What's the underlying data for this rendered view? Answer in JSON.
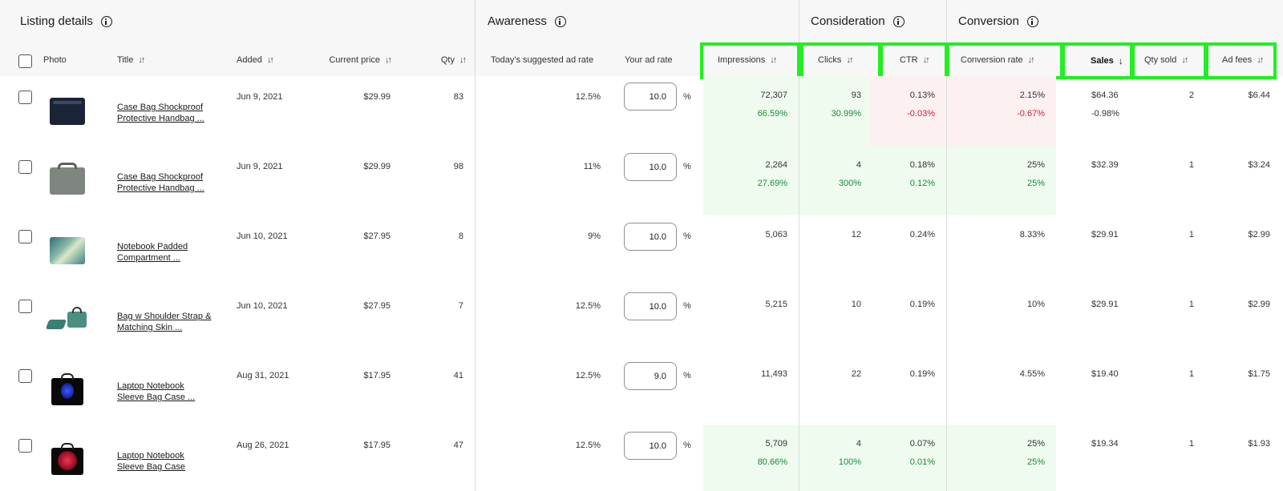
{
  "groups": {
    "listing_details": "Listing details",
    "awareness": "Awareness",
    "consideration": "Consideration",
    "conversion": "Conversion"
  },
  "columns": {
    "photo": "Photo",
    "title": "Title",
    "added": "Added",
    "current_price": "Current price",
    "qty": "Qty",
    "suggested_rate": "Today's suggested ad rate",
    "your_rate": "Your ad rate",
    "impressions": "Impressions",
    "clicks": "Clicks",
    "ctr": "CTR",
    "conversion_rate": "Conversion rate",
    "sales": "Sales",
    "qty_sold": "Qty sold",
    "ad_fees": "Ad fees"
  },
  "colors": {
    "highlight": "#22ee22",
    "positive": "#1a8a3a",
    "negative": "#d11d3c",
    "green_cell": "#eefbee",
    "red_cell": "#fdf0f0"
  },
  "rows": [
    {
      "title": "Case Bag Shockproof Protective Handbag ...",
      "added": "Jun 9, 2021",
      "price": "$29.99",
      "qty": "83",
      "suggested_rate": "12.5%",
      "ad_rate": "10.0",
      "impressions": "72,307",
      "impressions_delta": "66.59%",
      "clicks": "93",
      "clicks_delta": "30.99%",
      "ctr": "0.13%",
      "ctr_delta": "-0.03%",
      "conversion_rate": "2.15%",
      "conversion_rate_delta": "-0.67%",
      "sales": "$64.36",
      "sales_delta": "-0.98%",
      "qty_sold": "2",
      "ad_fees": "$6.44"
    },
    {
      "title": "Case Bag Shockproof Protective Handbag ...",
      "added": "Jun 9, 2021",
      "price": "$29.99",
      "qty": "98",
      "suggested_rate": "11%",
      "ad_rate": "10.0",
      "impressions": "2,264",
      "impressions_delta": "27.69%",
      "clicks": "4",
      "clicks_delta": "300%",
      "ctr": "0.18%",
      "ctr_delta": "0.12%",
      "conversion_rate": "25%",
      "conversion_rate_delta": "25%",
      "sales": "$32.39",
      "qty_sold": "1",
      "ad_fees": "$3.24"
    },
    {
      "title": "Notebook Padded Compartment ...",
      "added": "Jun 10, 2021",
      "price": "$27.95",
      "qty": "8",
      "suggested_rate": "9%",
      "ad_rate": "10.0",
      "impressions": "5,063",
      "clicks": "12",
      "ctr": "0.24%",
      "conversion_rate": "8.33%",
      "sales": "$29.91",
      "qty_sold": "1",
      "ad_fees": "$2.99"
    },
    {
      "title": "Bag w Shoulder Strap & Matching Skin ...",
      "added": "Jun 10, 2021",
      "price": "$27.95",
      "qty": "7",
      "suggested_rate": "12.5%",
      "ad_rate": "10.0",
      "impressions": "5,215",
      "clicks": "10",
      "ctr": "0.19%",
      "conversion_rate": "10%",
      "sales": "$29.91",
      "qty_sold": "1",
      "ad_fees": "$2.99"
    },
    {
      "title": "Laptop Notebook Sleeve Bag Case ...",
      "added": "Aug 31, 2021",
      "price": "$17.95",
      "qty": "41",
      "suggested_rate": "12.5%",
      "ad_rate": "9.0",
      "impressions": "11,493",
      "clicks": "22",
      "ctr": "0.19%",
      "conversion_rate": "4.55%",
      "sales": "$19.40",
      "qty_sold": "1",
      "ad_fees": "$1.75"
    },
    {
      "title": "Laptop Notebook Sleeve Bag Case",
      "added": "Aug 26, 2021",
      "price": "$17.95",
      "qty": "47",
      "suggested_rate": "12.5%",
      "ad_rate": "10.0",
      "impressions": "5,709",
      "impressions_delta": "80.66%",
      "clicks": "4",
      "clicks_delta": "100%",
      "ctr": "0.07%",
      "ctr_delta": "0.01%",
      "conversion_rate": "25%",
      "conversion_rate_delta": "25%",
      "sales": "$19.34",
      "qty_sold": "1",
      "ad_fees": "$1.93"
    }
  ],
  "percent_symbol": "%"
}
